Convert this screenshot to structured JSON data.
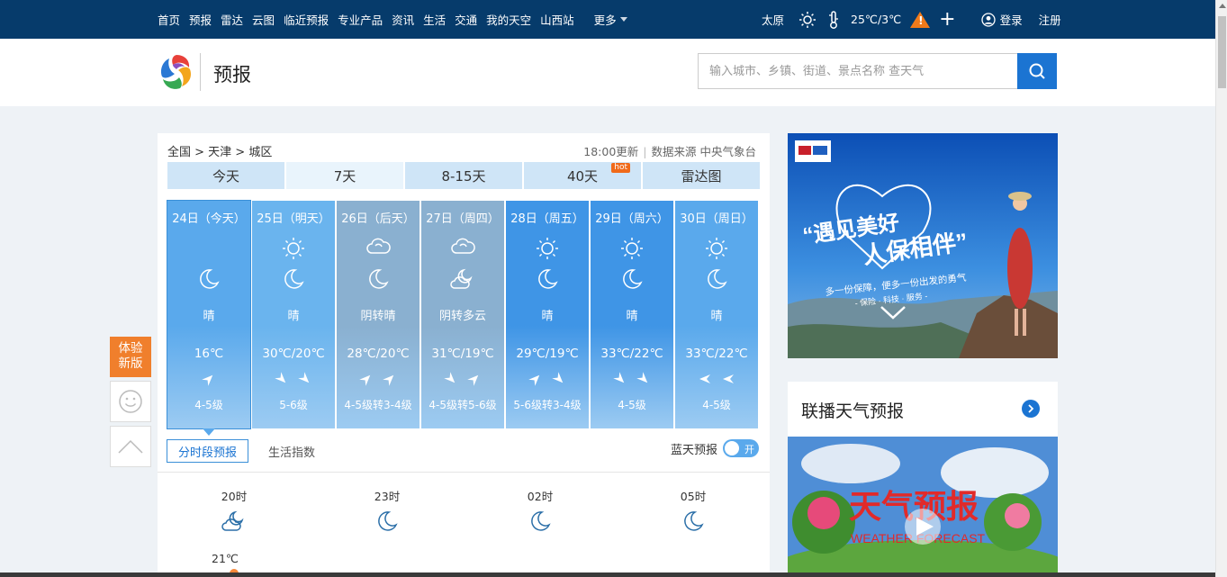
{
  "topnav": {
    "items": [
      "首页",
      "预报",
      "雷达",
      "云图",
      "临近预报",
      "专业产品",
      "资讯",
      "生活",
      "交通",
      "我的天空",
      "山西站"
    ],
    "more": "更多",
    "city": "太原",
    "temp": "25℃/3℃",
    "warning_mark": "!",
    "plus": "+",
    "login": "登录",
    "register": "注册"
  },
  "header": {
    "title": "预报",
    "search_placeholder": "输入城市、乡镇、街道、景点名称 查天气"
  },
  "main": {
    "breadcrumb": "全国 > 天津 > 城区",
    "update": "18:00更新",
    "source": "数据来源 中央气象台",
    "tabs": [
      "今天",
      "7天",
      "8-15天",
      "40天",
      "雷达图"
    ],
    "hot_badge": "hot",
    "days": [
      {
        "date": "24日（今天）",
        "desc": "晴",
        "temp": "16℃",
        "level": "4-5级",
        "icons": [
          "moon"
        ],
        "bg": "#5aa9ec"
      },
      {
        "date": "25日（明天）",
        "desc": "晴",
        "temp": "30℃/20℃",
        "level": "5-6级",
        "icons": [
          "sun",
          "moon"
        ],
        "bg": "#6ab4ee"
      },
      {
        "date": "26日（后天）",
        "desc": "阴转晴",
        "temp": "28℃/20℃",
        "level": "4-5级转3-4级",
        "icons": [
          "cloud",
          "moon"
        ],
        "bg": "#8ab0d0"
      },
      {
        "date": "27日（周四）",
        "desc": "阴转多云",
        "temp": "31℃/19℃",
        "level": "4-5级转5-6级",
        "icons": [
          "cloud",
          "cloud-moon"
        ],
        "bg": "#8ab0d0"
      },
      {
        "date": "28日（周五）",
        "desc": "晴",
        "temp": "29℃/19℃",
        "level": "5-6级转3-4级",
        "icons": [
          "sun",
          "moon"
        ],
        "bg": "#3f95e6"
      },
      {
        "date": "29日（周六）",
        "desc": "晴",
        "temp": "33℃/22℃",
        "level": "4-5级",
        "icons": [
          "sun",
          "moon"
        ],
        "bg": "#3f95e6"
      },
      {
        "date": "30日（周日）",
        "desc": "晴",
        "temp": "33℃/22℃",
        "level": "4-5级",
        "icons": [
          "sun",
          "moon"
        ],
        "bg": "#5aa9ec"
      }
    ],
    "subtabs": [
      "分时段预报",
      "生活指数"
    ],
    "bluesky_label": "蓝天预报",
    "toggle_label": "开",
    "hours": [
      {
        "time": "20时",
        "icon": "cloud-moon"
      },
      {
        "time": "23时",
        "icon": "moon"
      },
      {
        "time": "02时",
        "icon": "moon"
      },
      {
        "time": "05时",
        "icon": "moon"
      }
    ],
    "first_temp": "21℃"
  },
  "sidebar": {
    "feedback": "体验新版"
  },
  "ad": {
    "headline1": "“遇见美好",
    "headline2": "人保相伴”",
    "sub1": "多一份保障，便多一份出发的勇气",
    "sub2": "- 保险 · 科技 · 服务 -"
  },
  "broadcast": {
    "title": "联播天气预报",
    "video_title": "天气预报",
    "video_sub": "WEATHER FORECAST"
  },
  "colors": {
    "nav_bg": "#063b6b",
    "accent": "#1b74d2",
    "orange": "#f07f2c"
  }
}
